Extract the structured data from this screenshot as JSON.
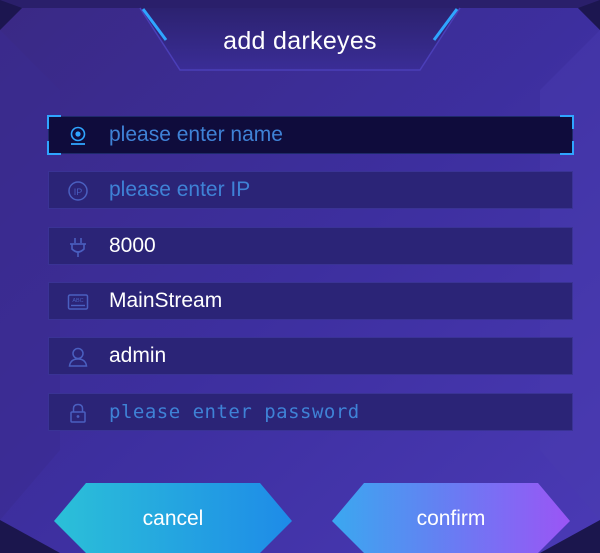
{
  "dialog": {
    "title": "add darkeyes",
    "fields": [
      {
        "icon": "camera-icon",
        "placeholder": "please enter name",
        "value": ""
      },
      {
        "icon": "ip-icon",
        "placeholder": "please enter IP",
        "value": ""
      },
      {
        "icon": "plug-icon",
        "placeholder": "",
        "value": "8000"
      },
      {
        "icon": "abc-keyboard-icon",
        "placeholder": "",
        "value": "MainStream"
      },
      {
        "icon": "user-icon",
        "placeholder": "",
        "value": "admin"
      },
      {
        "icon": "lock-icon",
        "placeholder": "please enter password",
        "value": ""
      }
    ],
    "cancel_label": "cancel",
    "confirm_label": "confirm"
  },
  "colors": {
    "panel_top": "#3b2a8e",
    "panel_bottom": "#3a2fa8",
    "accent_cyan": "#2fa5ff",
    "placeholder": "#3f82d6",
    "cancel_button": "#1ea3e6",
    "confirm_button": "#8a5cf5"
  }
}
